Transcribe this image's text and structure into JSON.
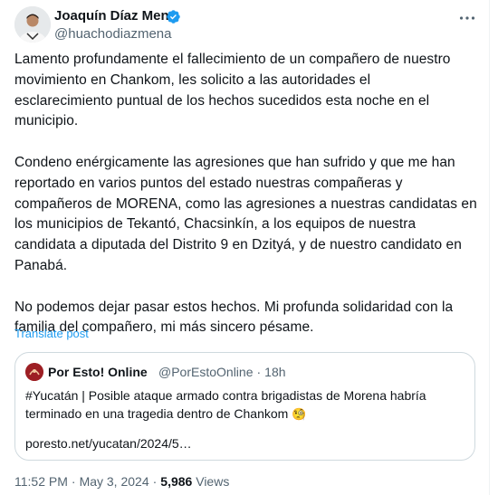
{
  "author": {
    "name": "Joaquín Díaz Mena",
    "handle": "@huachodiazmena",
    "verified_color": "#1d9bf0"
  },
  "tweet": {
    "paragraphs": [
      "Lamento profundamente el fallecimiento de un compañero de nuestro\nmovimiento en Chankom, les solicito a las autoridades el\nesclarecimiento puntual de los hechos sucedidos esta noche en el\nmunicipio.",
      "Condeno enérgicamente las agresiones que han sufrido y que me han\nreportado en varios puntos del estado nuestras compañeras y\ncompañeros de MORENA, como las agresiones a nuestras candidatas en\nlos municipios de Tekantó, Chacsinkín, a los equipos de nuestra\ncandidata a diputada del Distrito 9 en Dzityá, y de nuestro candidato en\nPanabá.",
      "No podemos dejar pasar estos hechos. Mi profunda solidaridad con la\nfamilia del compañero, mi más sincero pésame."
    ],
    "translate_label": "Translate post"
  },
  "quote": {
    "name": "Por Esto! Online",
    "handle": "@PorEstoOnline",
    "separator": "·",
    "time": "18h",
    "text_line1": "#Yucatán | Posible ataque armado contra brigadistas de Morena habría",
    "text_line2": "terminado en una tragedia dentro de Chankom",
    "emoji": "🧐",
    "link": "poresto.net/yucatan/2024/5…"
  },
  "footer": {
    "time": "11:52 PM",
    "separator": "·",
    "date": "May 3, 2024",
    "views_count": "5,986",
    "views_label": "Views"
  },
  "icons": {
    "verified": "verified-badge-icon",
    "more": "more-options-icon"
  }
}
